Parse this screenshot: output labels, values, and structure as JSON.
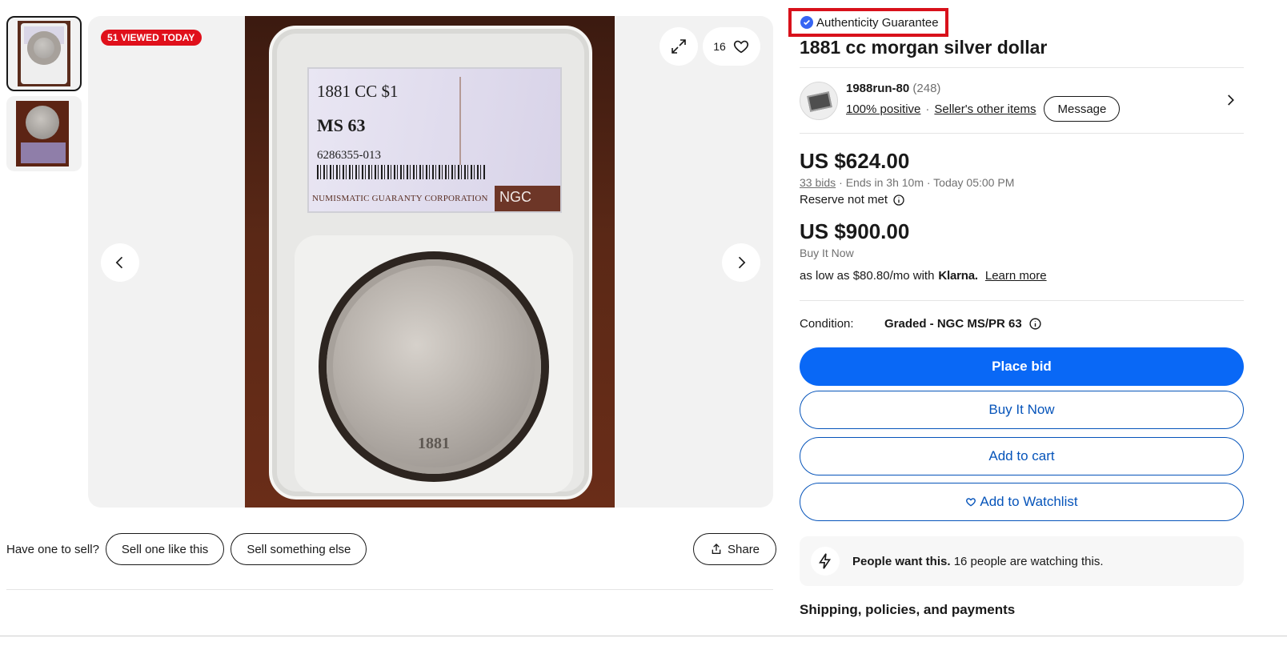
{
  "gallery": {
    "viewed_badge": "51 VIEWED TODAY",
    "watch_count": "16",
    "thumbnails": [
      {
        "icon": "slab-thumbnail",
        "active": true
      },
      {
        "icon": "coin-thumbnail",
        "active": false
      }
    ],
    "label_line1": "1881 CC $1",
    "label_grade": "MS 63",
    "label_cert": "6286355-013",
    "label_footer": "NUMISMATIC GUARANTY CORPORATION",
    "label_logo": "NGC",
    "coin_year": "1881"
  },
  "sell_row": {
    "question": "Have one to sell?",
    "sell_like_label": "Sell one like this",
    "sell_else_label": "Sell something else",
    "share_label": "Share"
  },
  "listing": {
    "authenticity": "Authenticity Guarantee",
    "title": "1881 cc morgan silver dollar"
  },
  "seller": {
    "name": "1988run-80",
    "count": "(248)",
    "positive": "100% positive",
    "other_items": "Seller's other items",
    "message_label": "Message"
  },
  "pricing": {
    "current_bid": "US $624.00",
    "bids": "33 bids",
    "ends": "· Ends in 3h 10m · Today 05:00 PM",
    "reserve": "Reserve not met",
    "buy_now_price": "US $900.00",
    "buy_now_label": "Buy It Now",
    "klarna_text": "as low as $80.80/mo with",
    "klarna_brand": "Klarna.",
    "learn_more": "Learn more"
  },
  "condition": {
    "label": "Condition:",
    "value": "Graded - NGC MS/PR 63"
  },
  "actions": {
    "place_bid": "Place bid",
    "buy_it_now": "Buy It Now",
    "add_to_cart": "Add to cart",
    "add_to_watchlist": "Add to Watchlist"
  },
  "urgency": {
    "strong": "People want this.",
    "detail": "16 people are watching this."
  },
  "shipping": {
    "heading": "Shipping, policies, and payments"
  },
  "colors": {
    "primary": "#0968f6",
    "link": "#0654ba",
    "badge_red": "#e0101b",
    "highlight_box": "#d8111b"
  }
}
